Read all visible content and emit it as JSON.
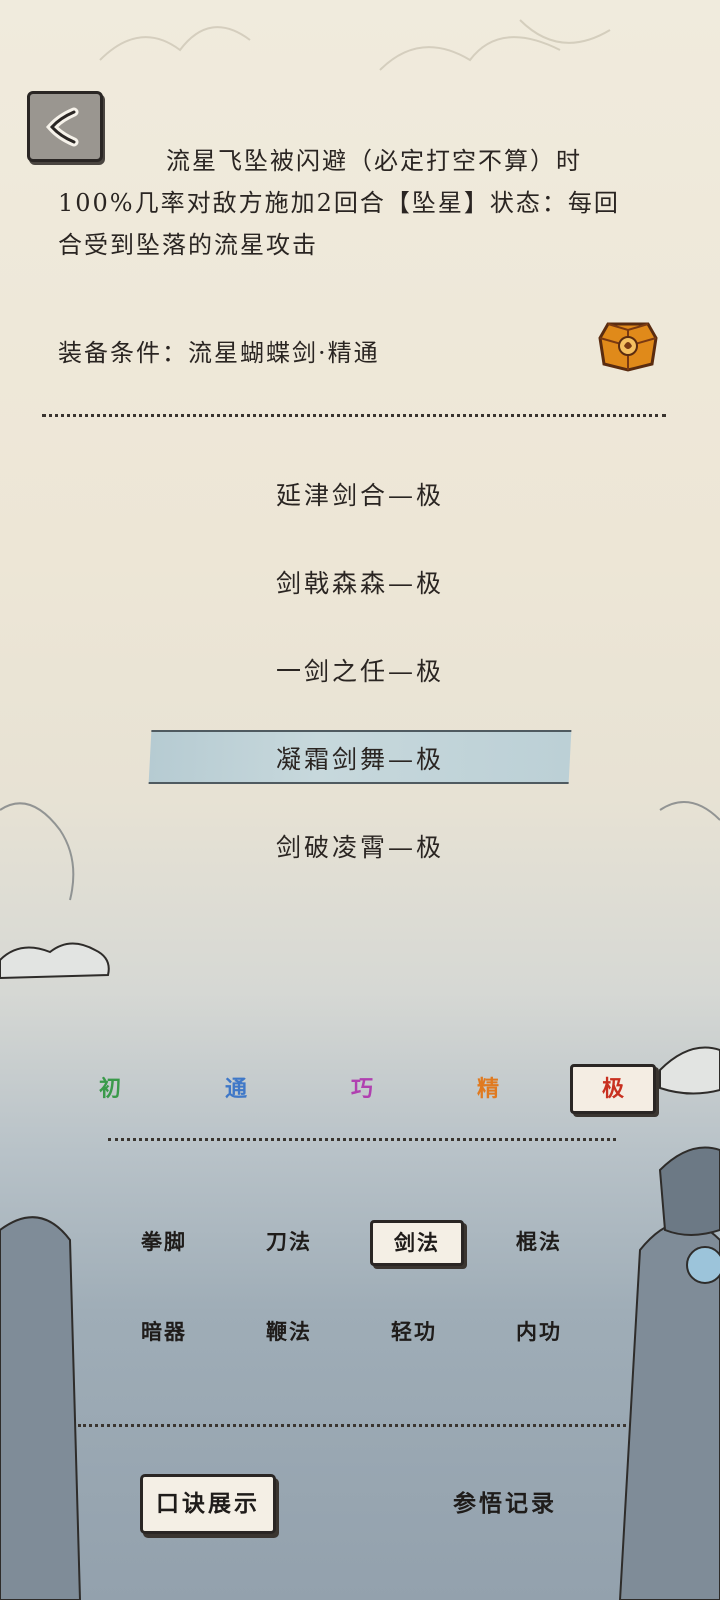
{
  "description": {
    "line1": "流星飞坠被闪避（必定打空不算）时",
    "line2": "100%几率对敌方施加2回合【坠星】状态：每回",
    "line3": "合受到坠落的流星攻击"
  },
  "equip_condition": "装备条件：流星蝴蝶剑·精通",
  "skills": [
    {
      "label": "延津剑合—极",
      "selected": false
    },
    {
      "label": "剑戟森森—极",
      "selected": false
    },
    {
      "label": "一剑之任—极",
      "selected": false
    },
    {
      "label": "凝霜剑舞—极",
      "selected": true
    },
    {
      "label": "剑破凌霄—极",
      "selected": false
    }
  ],
  "tiers": [
    {
      "label": "初",
      "color": "#3a9a4a"
    },
    {
      "label": "通",
      "color": "#3f78c8"
    },
    {
      "label": "巧",
      "color": "#b040b0"
    },
    {
      "label": "精",
      "color": "#e07a20"
    },
    {
      "label": "极",
      "color": "#c83020",
      "selected": true
    }
  ],
  "categories": [
    {
      "label": "拳脚"
    },
    {
      "label": "刀法"
    },
    {
      "label": "剑法",
      "selected": true
    },
    {
      "label": "棍法"
    },
    {
      "label": "暗器"
    },
    {
      "label": "鞭法"
    },
    {
      "label": "轻功"
    },
    {
      "label": "内功"
    }
  ],
  "bottom": {
    "formula_label": "口诀展示",
    "record_label": "参悟记录"
  },
  "icons": {
    "back": "back-arrow-icon",
    "chest": "treasure-chest-icon"
  }
}
